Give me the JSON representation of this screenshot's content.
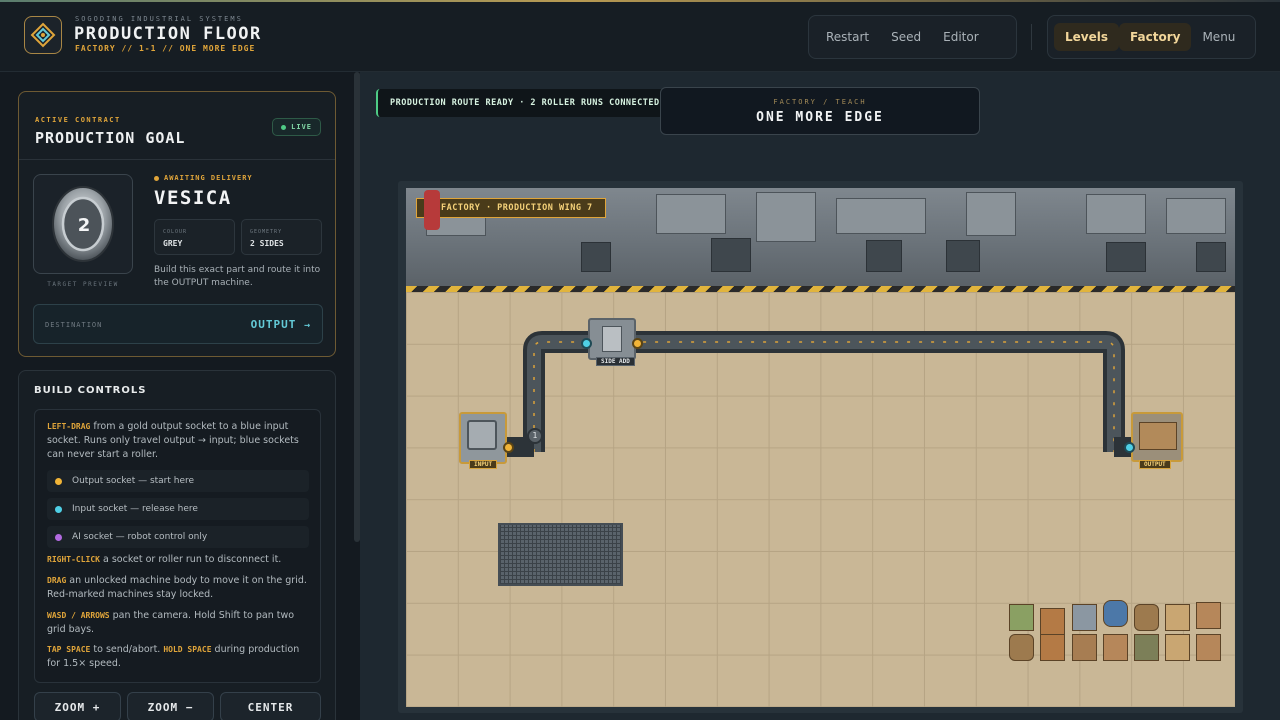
{
  "app": {
    "brand_subtitle": "SOGODING INDUSTRIAL SYSTEMS",
    "title": "PRODUCTION FLOOR",
    "breadcrumb": "FACTORY // 1-1 // ONE MORE EDGE"
  },
  "header": {
    "actions": [
      "Restart",
      "Seed",
      "Editor"
    ],
    "nav": [
      {
        "label": "Levels",
        "active": true
      },
      {
        "label": "Factory",
        "active": true
      },
      {
        "label": "Menu",
        "active": false
      }
    ]
  },
  "contract": {
    "kicker": "ACTIVE CONTRACT",
    "title": "PRODUCTION GOAL",
    "live_label": "LIVE",
    "preview_value": "2",
    "preview_caption": "TARGET PREVIEW",
    "status": "AWAITING DELIVERY",
    "part_name": "VESICA",
    "attributes": [
      {
        "key": "COLOUR",
        "value": "GREY"
      },
      {
        "key": "GEOMETRY",
        "value": "2 SIDES"
      }
    ],
    "instruction": "Build this exact part and route it into the OUTPUT machine.",
    "destination_label": "DESTINATION",
    "destination_value": "OUTPUT",
    "destination_icon": "arrow-right-icon"
  },
  "build_controls": {
    "title": "BUILD CONTROLS",
    "drag_key": "LEFT-DRAG",
    "drag_text": "from a gold output socket to a blue input socket. Runs only travel output → input; blue sockets can never start a roller.",
    "legend": [
      {
        "label": "Output socket — start here",
        "color": "#f1b437"
      },
      {
        "label": "Input socket — release here",
        "color": "#4fd0e6"
      },
      {
        "label": "AI socket — robot control only",
        "color": "#b26ae0"
      }
    ],
    "rightclick_key": "RIGHT-CLICK",
    "rightclick_text": "a socket or roller run to disconnect it.",
    "move_key": "DRAG",
    "move_text": "an unlocked machine body to move it on the grid. Red-marked machines stay locked.",
    "camera_key": "WASD / ARROWS",
    "camera_text": "pan the camera. Hold Shift to pan two grid bays.",
    "space_key": "TAP SPACE",
    "space_text": "to send/abort.",
    "hold_key": "HOLD SPACE",
    "hold_text": "during production for 1.5× speed.",
    "buttons": [
      "ZOOM +",
      "ZOOM −",
      "CENTER"
    ]
  },
  "stage": {
    "route_banner": "PRODUCTION ROUTE READY · 2 ROLLER RUNS CONNECTED",
    "level_kicker": "FACTORY / TEACH",
    "level_name": "ONE MORE EDGE",
    "wall_sign": "FACTORY · PRODUCTION WING 7",
    "machines": {
      "input_label": "INPUT",
      "middle_label": "SIDE ADD",
      "output_label": "OUTPUT",
      "counter_value": "1"
    }
  },
  "colors": {
    "accent_gold": "#e0a53a",
    "accent_cyan": "#63c9d6",
    "live_green": "#4ecb85"
  }
}
